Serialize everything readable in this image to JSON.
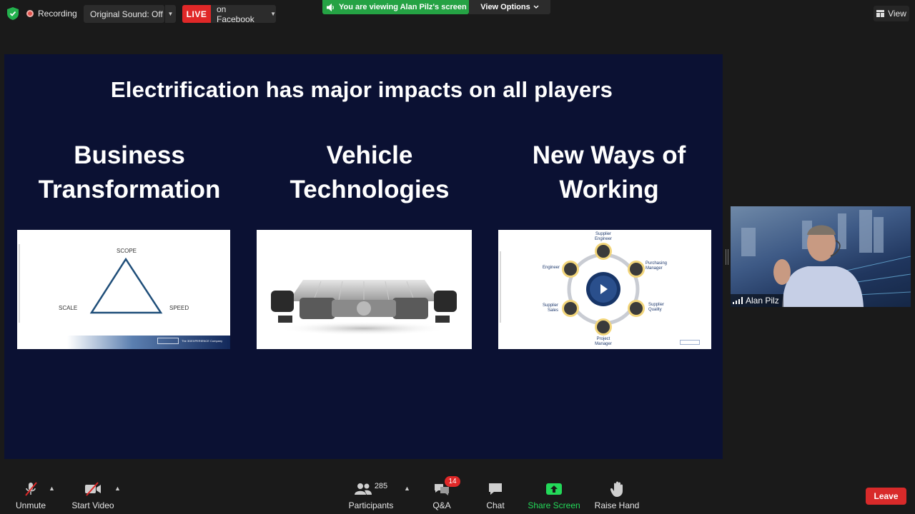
{
  "topbar": {
    "recording_label": "Recording",
    "sound_label": "Original Sound: Off",
    "live_label": "LIVE",
    "live_target": "on Facebook",
    "viewing_banner": "You are viewing Alan Pilz's screen",
    "view_options_label": "View Options",
    "view_label": "View"
  },
  "slide": {
    "title": "Electrification has major impacts on all players",
    "columns": [
      {
        "line1": "Business",
        "line2": "Transformation"
      },
      {
        "line1": "Vehicle",
        "line2": "Technologies"
      },
      {
        "line1": "New Ways of",
        "line2": "Working"
      }
    ],
    "thumb1": {
      "scope": "SCOPE",
      "scale": "SCALE",
      "speed": "SPEED",
      "footer": "The 3DEXPERIENCE Company"
    },
    "thumb3": {
      "roles": [
        {
          "l1": "Supplier",
          "l2": "Engineer"
        },
        {
          "l1": "Purchasing",
          "l2": "Manager"
        },
        {
          "l1": "Supplier",
          "l2": "Quality"
        },
        {
          "l1": "Project",
          "l2": "Manager"
        },
        {
          "l1": "Supplier",
          "l2": "Sales"
        },
        {
          "l1": "Engineer",
          "l2": ""
        }
      ]
    }
  },
  "video": {
    "participant_name": "Alan Pilz"
  },
  "toolbar": {
    "unmute": "Unmute",
    "start_video": "Start Video",
    "participants": "Participants",
    "participants_count": "285",
    "qa": "Q&A",
    "qa_badge": "14",
    "chat": "Chat",
    "share_screen": "Share Screen",
    "raise_hand": "Raise Hand",
    "leave": "Leave"
  },
  "colors": {
    "live_red": "#e02828",
    "banner_green": "#25a244",
    "share_green": "#23d959",
    "slide_navy": "#0b1133",
    "diagram_blue": "#1f4e79"
  }
}
